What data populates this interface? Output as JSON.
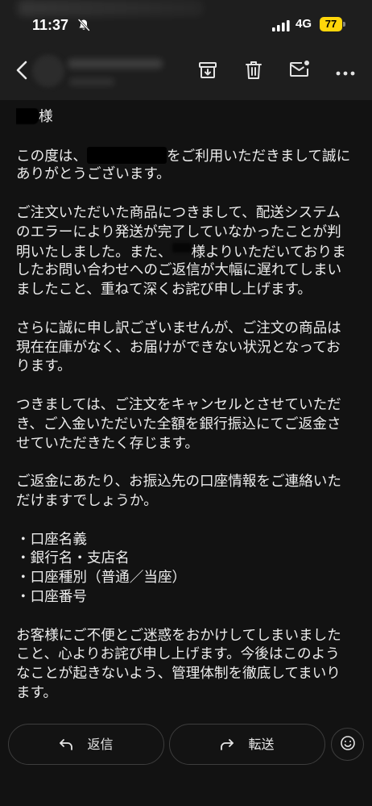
{
  "theme": {
    "background": "#121212",
    "app_bar": "#1e1e1e",
    "text": "#ececec",
    "battery": "#ffd60a"
  },
  "status_bar": {
    "time": "11:37",
    "network": "4G",
    "battery_level": "77",
    "icons": [
      "bell-slash-icon",
      "cellular-signal-icon",
      "battery-icon"
    ]
  },
  "toolbar": {
    "icons": [
      "back-chevron-icon",
      "archive-icon",
      "trash-icon",
      "mark-unread-icon",
      "more-icon"
    ]
  },
  "message": {
    "greeting": {
      "honorific": "様"
    },
    "paragraphs": [
      {
        "lines": [
          {
            "pre": "この度は、",
            "post": "をご利用いただきまして誠に"
          },
          "ありがとうございます。"
        ]
      },
      {
        "lines": [
          "ご注文いただいた商品につきまして、配送システム",
          "のエラーにより発送が完了していなかったことが判",
          {
            "pre": "明いたしました。また、",
            "post": "様よりいただいておりま"
          },
          "したお問い合わせへのご返信が大幅に遅れてしまい",
          "ましたこと、重ねて深くお詫び申し上げます。"
        ]
      },
      {
        "lines": [
          "さらに誠に申し訳ございませんが、ご注文の商品は",
          "現在在庫がなく、お届けができない状況となってお",
          "ります。"
        ]
      },
      {
        "lines": [
          "つきましては、ご注文をキャンセルとさせていただ",
          "き、ご入金いただいた全額を銀行振込にてご返金さ",
          "せていただきたく存じます。"
        ]
      },
      {
        "lines": [
          "ご返金にあたり、お振込先の口座情報をご連絡いた",
          "だけますでしょうか。"
        ]
      },
      {
        "lines": [
          "・口座名義",
          "・銀行名・支店名",
          "・口座種別（普通／当座）",
          "・口座番号"
        ]
      },
      {
        "lines": [
          "お客様にご不便とご迷惑をおかけしてしまいました",
          "こと、心よりお詫び申し上げます。今後はこのよう",
          "なことが起きないよう、管理体制を徹底してまいり",
          "ます。"
        ]
      }
    ]
  },
  "actions": {
    "reply_label": "返信",
    "forward_label": "転送",
    "icons": [
      "reply-icon",
      "forward-icon",
      "emoji-reaction-icon"
    ]
  }
}
